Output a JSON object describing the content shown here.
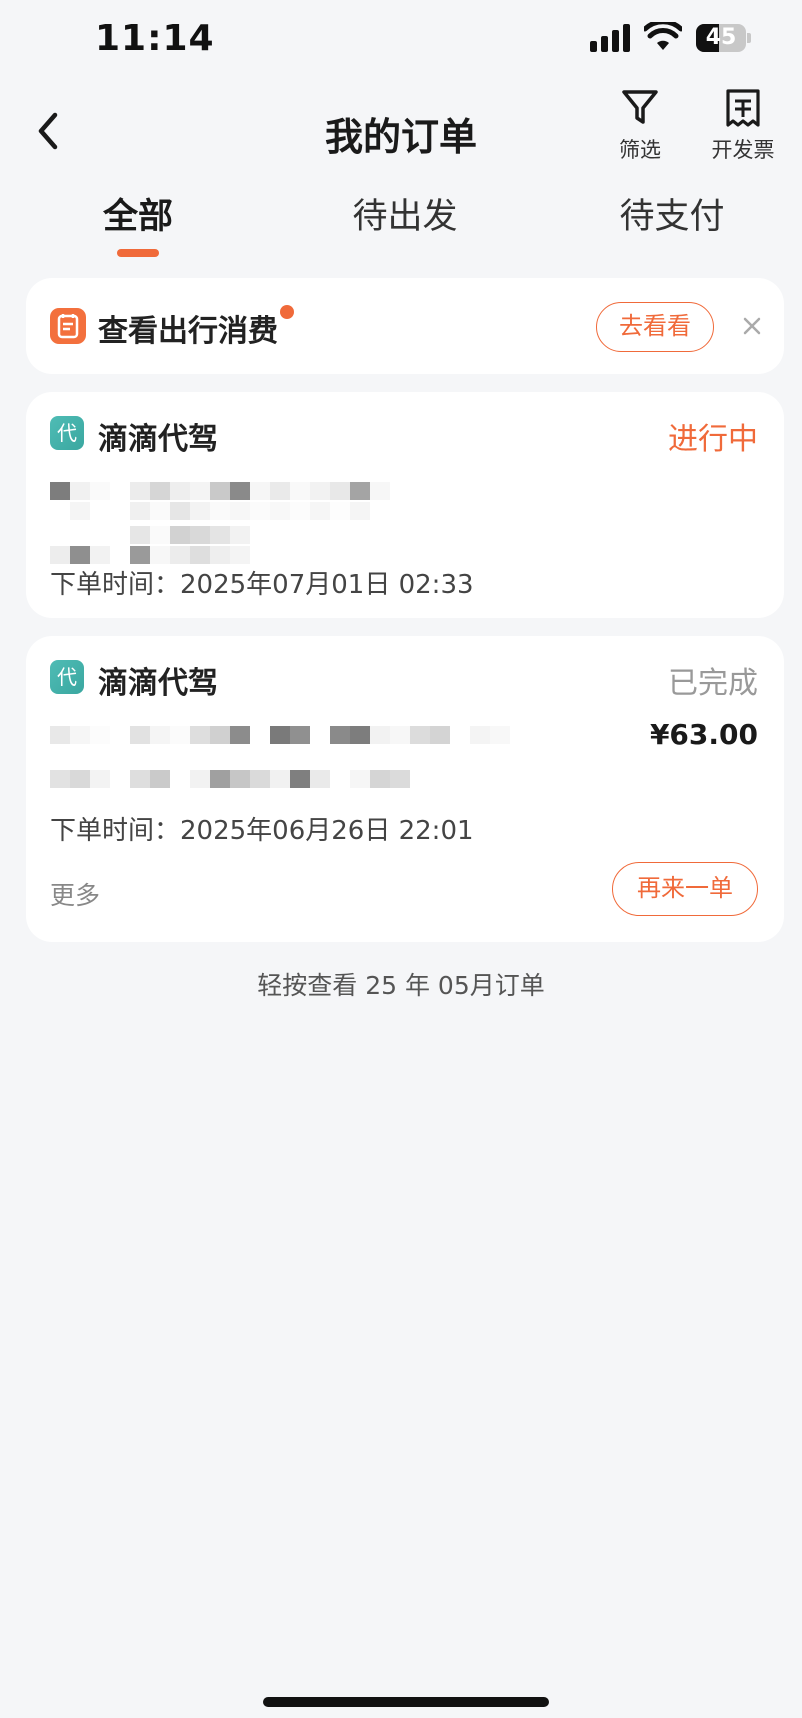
{
  "status_bar": {
    "time": "11:14",
    "battery": "45",
    "battery_level": 0.45,
    "icons": [
      "signal-icon",
      "wifi-icon",
      "battery-icon"
    ]
  },
  "nav": {
    "back_icon": "chevron-left-icon",
    "title": "我的订单",
    "filter_label": "筛选",
    "filter_icon": "funnel-icon",
    "invoice_label": "开发票",
    "invoice_icon": "invoice-icon"
  },
  "tabs": [
    {
      "label": "全部",
      "active": true
    },
    {
      "label": "待出发",
      "active": false
    },
    {
      "label": "待支付",
      "active": false
    }
  ],
  "promo": {
    "icon": "expense-icon",
    "title": "查看出行消费",
    "action_label": "去看看",
    "close_icon": "close-icon"
  },
  "orders": [
    {
      "badge": "代",
      "service": "滴滴代驾",
      "status": "进行中",
      "order_time": "下单时间：2025年07月01日 02:33",
      "price": "",
      "more": "",
      "reorder": ""
    },
    {
      "badge": "代",
      "service": "滴滴代驾",
      "status": "已完成",
      "order_time": "下单时间：2025年06月26日 22:01",
      "price": "¥63.00",
      "more": "更多",
      "reorder": "再来一单"
    }
  ],
  "history_link": "轻按查看 25 年 05月订单",
  "colors": {
    "accent": "#f06a3a",
    "background": "#f5f6f8",
    "badge": "#3aa7a0",
    "completed": "#999999"
  }
}
